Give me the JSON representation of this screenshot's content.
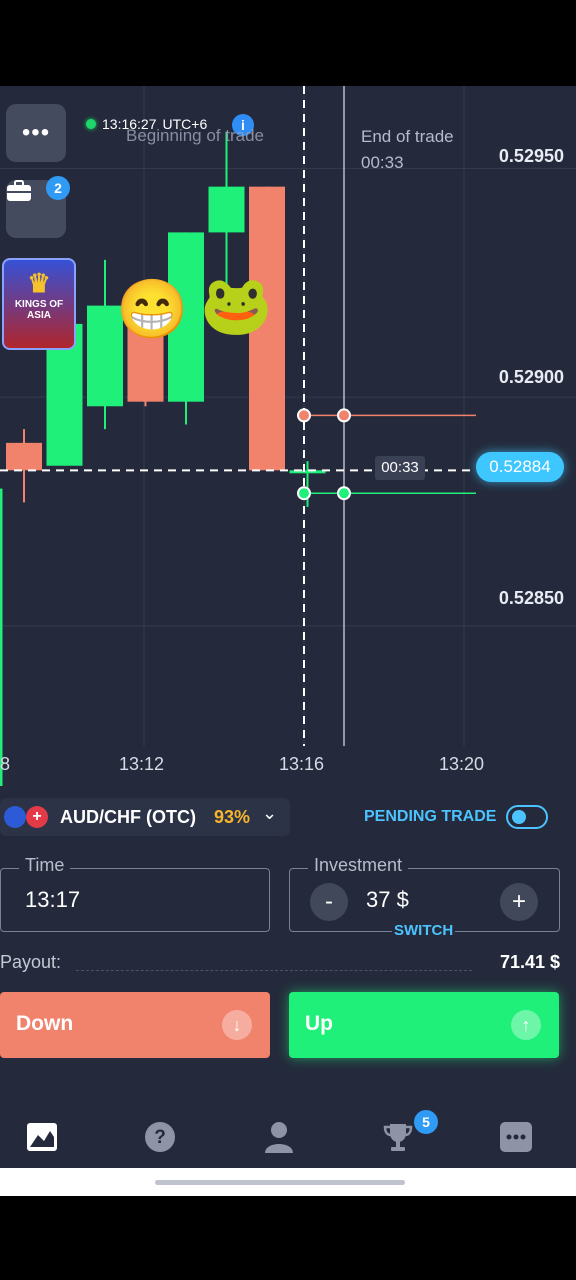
{
  "header": {
    "clock_time": "13:16:27",
    "timezone": "UTC+6",
    "beginning_label": "Beginning of trade",
    "end_label": "End of trade",
    "end_countdown": "00:33"
  },
  "sidebar": {
    "menu_icon": "more-dots-icon",
    "portfolio_icon": "briefcase-icon",
    "portfolio_badge": "2",
    "promo_label": "KINGS OF ASIA"
  },
  "chart": {
    "price_labels": [
      "0.52950",
      "0.52900",
      "0.52850"
    ],
    "current_price": "0.52884",
    "trade_countdown": "00:33",
    "time_labels": [
      "8",
      "13:12",
      "13:16",
      "13:20"
    ],
    "emojis": [
      "😁",
      "🐸"
    ]
  },
  "chart_data": {
    "type": "candlestick",
    "x": [
      "13:09",
      "13:10",
      "13:11",
      "13:12",
      "13:13",
      "13:14",
      "13:15",
      "13:16"
    ],
    "candles": [
      {
        "open": 0.52884,
        "close": 0.5289,
        "high": 0.52893,
        "low": 0.52877,
        "color": "red"
      },
      {
        "open": 0.52885,
        "close": 0.52916,
        "high": 0.52919,
        "low": 0.52885,
        "color": "green"
      },
      {
        "open": 0.52898,
        "close": 0.5292,
        "high": 0.5293,
        "low": 0.52893,
        "color": "green"
      },
      {
        "open": 0.5292,
        "close": 0.52899,
        "high": 0.5292,
        "low": 0.52898,
        "color": "red"
      },
      {
        "open": 0.52899,
        "close": 0.52936,
        "high": 0.52936,
        "low": 0.52894,
        "color": "green"
      },
      {
        "open": 0.52936,
        "close": 0.52946,
        "high": 0.52958,
        "low": 0.52915,
        "color": "green"
      },
      {
        "open": 0.52946,
        "close": 0.52884,
        "high": 0.52946,
        "low": 0.52884,
        "color": "red"
      },
      {
        "open": 0.52884,
        "close": 0.52884,
        "high": 0.52886,
        "low": 0.52876,
        "color": "green"
      }
    ],
    "current_value": 0.52884,
    "ylim": [
      0.52815,
      0.52968
    ],
    "y_ticks": [
      0.5295,
      0.529,
      0.5285
    ],
    "grid": true
  },
  "controls": {
    "asset_name": "AUD/CHF (OTC)",
    "asset_payout_pct": "93%",
    "pending_trade_label": "PENDING TRADE",
    "time_label": "Time",
    "time_value": "13:17",
    "investment_label": "Investment",
    "investment_value": "37 $",
    "minus_label": "-",
    "plus_label": "+",
    "switch_label": "SWITCH",
    "payout_label": "Payout:",
    "payout_value": "71.41 $",
    "down_label": "Down",
    "up_label": "Up"
  },
  "navbar": {
    "items": [
      "chart-icon",
      "help-icon",
      "profile-icon",
      "trophy-icon",
      "more-icon"
    ],
    "trophy_badge": "5"
  },
  "colors": {
    "background": "#242a3b",
    "bull": "#1ff07a",
    "bear": "#f1826c",
    "accent": "#3ec6ff"
  }
}
